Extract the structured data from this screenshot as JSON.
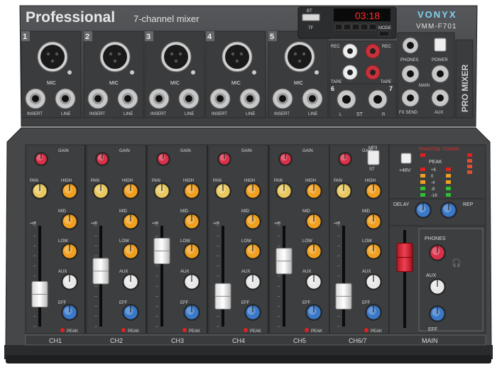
{
  "brand": {
    "title": "Professional",
    "subtitle": "7-channel mixer",
    "logo": "VONYX",
    "model": "VMM-F701",
    "side_label": "PRO MIXER"
  },
  "top_panel": {
    "channel_numbers": [
      "1",
      "2",
      "3",
      "4",
      "5"
    ],
    "mic_label": "MIC",
    "insert_label": "INSERT",
    "line_label": "LINE",
    "ch67_numbers": [
      "6",
      "7"
    ],
    "st_label": "ST",
    "st_l": "L",
    "st_r": "R",
    "player": {
      "bt_label": "BT",
      "tf_label": "TF",
      "display_text": "03:18",
      "mode_label": "MODE"
    },
    "rec_label": "REC",
    "tape_label": "TAPE",
    "phones_label": "PHONES",
    "power_label": "POWER",
    "main_label": "MAIN",
    "fx_send_label": "FX SEND",
    "aux_label": "AUX"
  },
  "channel_strip": {
    "gain_label": "GAIN",
    "pan_label": "PAN",
    "high_label": "HIGH",
    "mid_label": "MID",
    "low_label": "LOW",
    "aux_label": "AUX",
    "eff_label": "EFF",
    "peak_label": "PEAK",
    "db_label": "+dB",
    "mp3_label": "MP3",
    "st_label": "ST"
  },
  "channels": [
    {
      "name": "CH1",
      "fader_level": 0.32
    },
    {
      "name": "CH2",
      "fader_level": 0.55
    },
    {
      "name": "CH3",
      "fader_level": 0.75
    },
    {
      "name": "CH4",
      "fader_level": 0.3
    },
    {
      "name": "CH5",
      "fader_level": 0.65
    },
    {
      "name": "CH6/7",
      "fader_level": 0.3
    }
  ],
  "master": {
    "phantom_label": "PHANTOM",
    "power_label": "POWER",
    "peak_label": "PEAK",
    "v48_label": "+48V",
    "meter_labels": [
      "+6",
      "0",
      "-4",
      "-8",
      "-16"
    ],
    "delay_label": "DELAY",
    "rep_label": "REP",
    "phones_label": "PHONES",
    "aux_label": "AUX",
    "eff_label": "EFF",
    "main_label": "MAIN",
    "fader_level": 0.72
  },
  "colors": {
    "body": "#4a4c4e",
    "panel": "#3a3c3e",
    "gain_knob": "#d8324a",
    "pan_knob": "#e8c860",
    "eq_knob": "#f0a020",
    "aux_knob": "#e8e8e8",
    "eff_knob": "#3a78c8",
    "display": "#e0202a"
  }
}
